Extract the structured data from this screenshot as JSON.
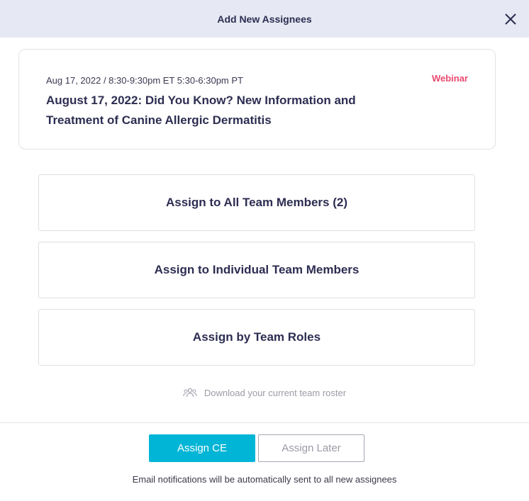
{
  "modal": {
    "title": "Add New Assignees",
    "close_icon": "close-icon"
  },
  "event": {
    "date_time": "Aug 17, 2022 / 8:30-9:30pm ET 5:30-6:30pm PT",
    "title": "August 17, 2022: Did You Know? New Information and Treatment of Canine Allergic Dermatitis",
    "type": "Webinar"
  },
  "options": [
    {
      "label": "Assign to All Team Members (2)"
    },
    {
      "label": "Assign to Individual Team Members"
    },
    {
      "label": "Assign by Team Roles"
    }
  ],
  "roster": {
    "icon": "team-icon",
    "label": "Download your current team roster"
  },
  "actions": {
    "primary_label": "Assign CE",
    "secondary_label": "Assign Later"
  },
  "footer": {
    "note": "Email notifications will be automatically sent to all new assignees"
  },
  "colors": {
    "header_bg": "#e6e8f3",
    "accent": "#00b5d6",
    "webinar": "#e94a6f",
    "text_dark": "#2d2d52"
  }
}
